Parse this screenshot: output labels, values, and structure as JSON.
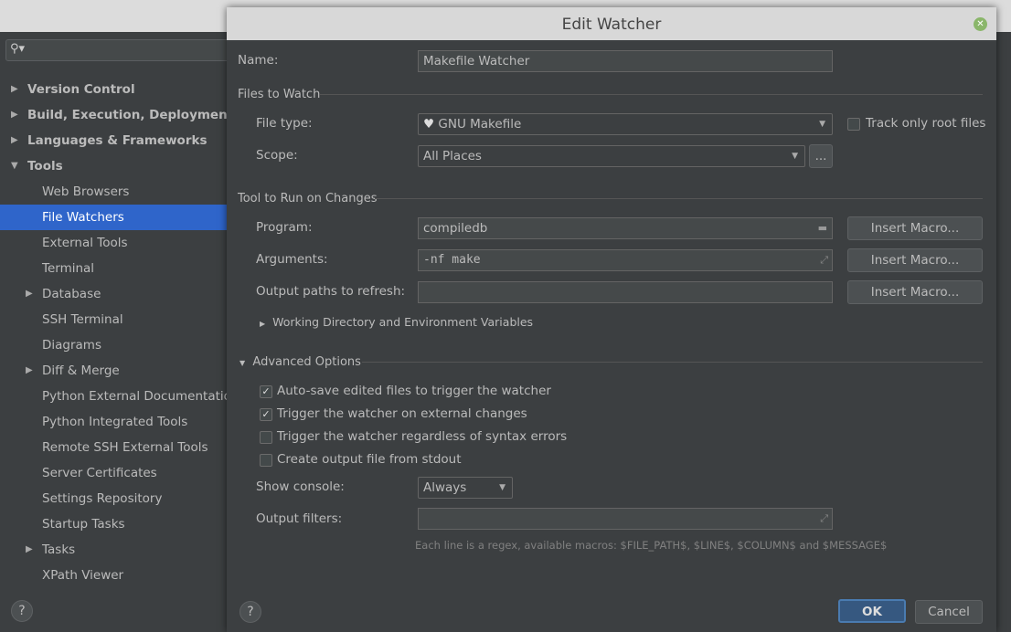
{
  "sidebar": {
    "search_placeholder": "",
    "items": [
      {
        "label": "Version Control",
        "bold": true,
        "arrow": "▶"
      },
      {
        "label": "Build, Execution, Deployment",
        "bold": true,
        "arrow": "▶"
      },
      {
        "label": "Languages & Frameworks",
        "bold": true,
        "arrow": "▶"
      },
      {
        "label": "Tools",
        "bold": true,
        "arrow": "▼"
      },
      {
        "label": "Web Browsers"
      },
      {
        "label": "File Watchers",
        "selected": true
      },
      {
        "label": "External Tools"
      },
      {
        "label": "Terminal"
      },
      {
        "label": "Database",
        "arrow": "▶"
      },
      {
        "label": "SSH Terminal"
      },
      {
        "label": "Diagrams"
      },
      {
        "label": "Diff & Merge",
        "arrow": "▶"
      },
      {
        "label": "Python External Documentation"
      },
      {
        "label": "Python Integrated Tools"
      },
      {
        "label": "Remote SSH External Tools"
      },
      {
        "label": "Server Certificates"
      },
      {
        "label": "Settings Repository"
      },
      {
        "label": "Startup Tasks"
      },
      {
        "label": "Tasks",
        "arrow": "▶"
      },
      {
        "label": "XPath Viewer"
      }
    ],
    "help": "?"
  },
  "dialog": {
    "title": "Edit Watcher",
    "name_label": "Name:",
    "name_value": "Makefile Watcher",
    "files_to_watch": "Files to Watch",
    "file_type_label": "File type:",
    "file_type_value": "GNU Makefile",
    "track_root": "Track only root files",
    "track_root_checked": false,
    "scope_label": "Scope:",
    "scope_value": "All Places",
    "scope_more": "...",
    "tool_section": "Tool to Run on Changes",
    "program_label": "Program:",
    "program_value": "compiledb",
    "arguments_label": "Arguments:",
    "arguments_value": "-nf make",
    "output_paths_label": "Output paths to refresh:",
    "output_paths_value": "",
    "insert_macro": "Insert Macro...",
    "working_dir": "Working Directory and Environment Variables",
    "advanced": "Advanced Options",
    "options": [
      {
        "label": "Auto-save edited files to trigger the watcher",
        "checked": true
      },
      {
        "label": "Trigger the watcher on external changes",
        "checked": true
      },
      {
        "label": "Trigger the watcher regardless of syntax errors",
        "checked": false
      },
      {
        "label": "Create output file from stdout",
        "checked": false
      }
    ],
    "show_console_label": "Show console:",
    "show_console_value": "Always",
    "output_filters_label": "Output filters:",
    "output_filters_value": "",
    "hint": "Each line is a regex, available macros: $FILE_PATH$, $LINE$, $COLUMN$ and $MESSAGE$",
    "ok": "OK",
    "cancel": "Cancel",
    "help": "?"
  },
  "colors": {
    "selection": "#2f65ca",
    "ok_button": "#365880",
    "close": "#8ab66a"
  }
}
